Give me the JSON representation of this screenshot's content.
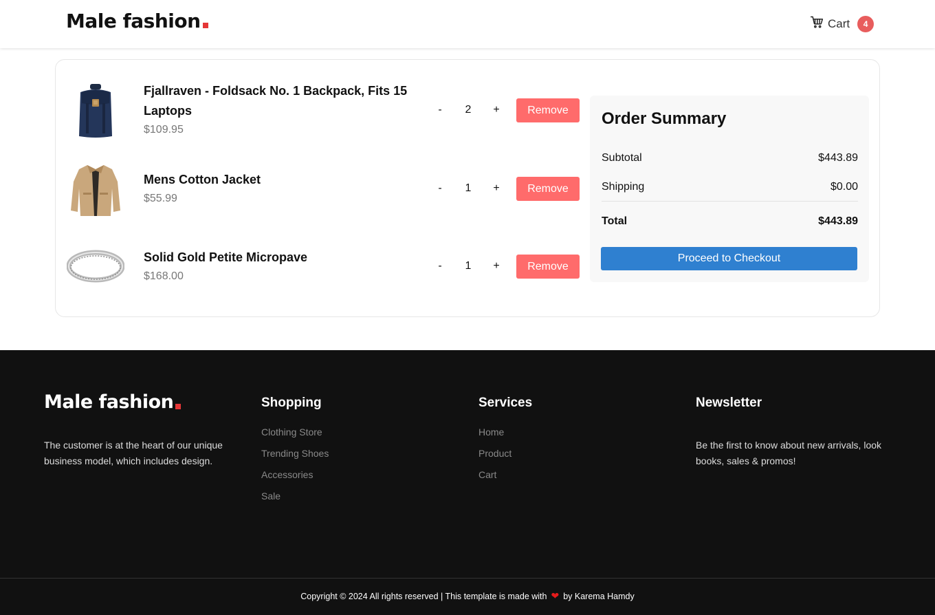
{
  "header": {
    "brand": "Male fashion",
    "cart_label": "Cart",
    "cart_count": "4"
  },
  "cart": {
    "items": [
      {
        "title": "Fjallraven - Foldsack No. 1 Backpack, Fits 15 Laptops",
        "price": "$109.95",
        "qty": "2",
        "minus": "-",
        "plus": "+",
        "remove_label": "Remove",
        "icon": "backpack-image"
      },
      {
        "title": "Mens Cotton Jacket",
        "price": "$55.99",
        "qty": "1",
        "minus": "-",
        "plus": "+",
        "remove_label": "Remove",
        "icon": "jacket-image"
      },
      {
        "title": "Solid Gold Petite Micropave",
        "price": "$168.00",
        "qty": "1",
        "minus": "-",
        "plus": "+",
        "remove_label": "Remove",
        "icon": "ring-image"
      }
    ]
  },
  "summary": {
    "title": "Order Summary",
    "subtotal_label": "Subtotal",
    "subtotal_value": "$443.89",
    "shipping_label": "Shipping",
    "shipping_value": "$0.00",
    "total_label": "Total",
    "total_value": "$443.89",
    "checkout_label": "Proceed to Checkout"
  },
  "footer": {
    "brand": "Male fashion",
    "about": "The customer is at the heart of our unique business model, which includes design.",
    "shopping": {
      "title": "Shopping",
      "links": [
        "Clothing Store",
        "Trending Shoes",
        "Accessories",
        "Sale"
      ]
    },
    "services": {
      "title": "Services",
      "links": [
        "Home",
        "Product",
        "Cart"
      ]
    },
    "newsletter": {
      "title": "Newsletter",
      "text": "Be the first to know about new arrivals, look books, sales & promos!"
    },
    "copyright_prefix": "Copyright © 2024 All rights reserved | This template is made with",
    "copyright_suffix": "by Karema Hamdy"
  },
  "colors": {
    "accent_red": "#e53637",
    "remove_button": "#ff6b6b",
    "checkout_button": "#2f80d0",
    "badge": "#e85d5d",
    "footer_bg": "#111111"
  }
}
